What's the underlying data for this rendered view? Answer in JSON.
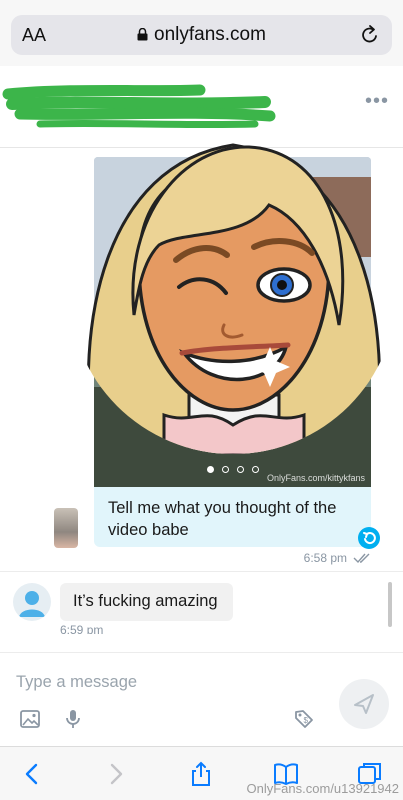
{
  "browser": {
    "text_size_label": "AA",
    "url": "onlyfans.com",
    "toolbar": [
      "back",
      "forward",
      "share",
      "bookmarks",
      "tabs"
    ]
  },
  "chat": {
    "header_menu": "•••",
    "messages": [
      {
        "direction": "outgoing",
        "media_watermark": "OnlyFans.com/kittykfans",
        "media_page_count": 4,
        "media_active_page": 1,
        "text": "Tell me what you thought of the video babe",
        "time": "6:58 pm"
      },
      {
        "direction": "incoming",
        "text": "It’s fucking amazing",
        "time": "6:59 pm"
      }
    ]
  },
  "composer": {
    "placeholder": "Type a message"
  },
  "watermark": "OnlyFans.com/u13921942",
  "colors": {
    "accent": "#00aff0",
    "outgoing_bubble": "#e1f5fb",
    "incoming_bubble": "#f1f1f1",
    "redaction": "#3cb54a"
  }
}
